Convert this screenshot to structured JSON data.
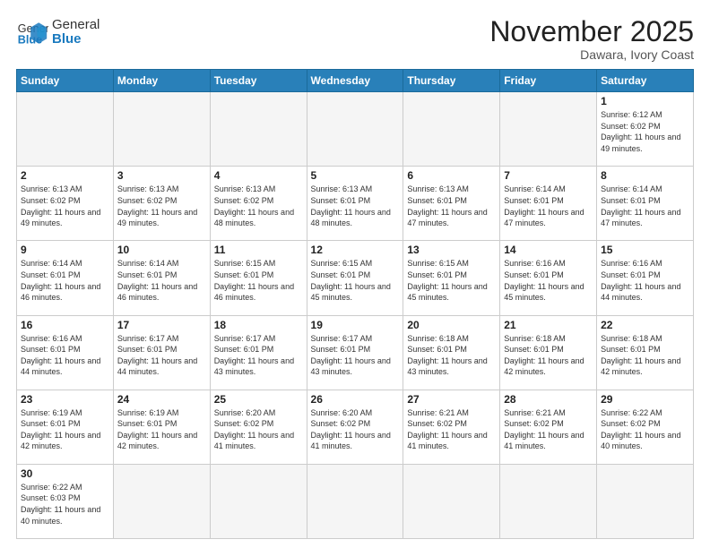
{
  "header": {
    "logo_general": "General",
    "logo_blue": "Blue",
    "title": "November 2025",
    "location": "Dawara, Ivory Coast"
  },
  "days_of_week": [
    "Sunday",
    "Monday",
    "Tuesday",
    "Wednesday",
    "Thursday",
    "Friday",
    "Saturday"
  ],
  "weeks": [
    [
      {
        "day": null
      },
      {
        "day": null
      },
      {
        "day": null
      },
      {
        "day": null
      },
      {
        "day": null
      },
      {
        "day": null
      },
      {
        "day": 1,
        "sunrise": "Sunrise: 6:12 AM",
        "sunset": "Sunset: 6:02 PM",
        "daylight": "Daylight: 11 hours and 49 minutes."
      }
    ],
    [
      {
        "day": 2,
        "sunrise": "Sunrise: 6:13 AM",
        "sunset": "Sunset: 6:02 PM",
        "daylight": "Daylight: 11 hours and 49 minutes."
      },
      {
        "day": 3,
        "sunrise": "Sunrise: 6:13 AM",
        "sunset": "Sunset: 6:02 PM",
        "daylight": "Daylight: 11 hours and 49 minutes."
      },
      {
        "day": 4,
        "sunrise": "Sunrise: 6:13 AM",
        "sunset": "Sunset: 6:02 PM",
        "daylight": "Daylight: 11 hours and 48 minutes."
      },
      {
        "day": 5,
        "sunrise": "Sunrise: 6:13 AM",
        "sunset": "Sunset: 6:01 PM",
        "daylight": "Daylight: 11 hours and 48 minutes."
      },
      {
        "day": 6,
        "sunrise": "Sunrise: 6:13 AM",
        "sunset": "Sunset: 6:01 PM",
        "daylight": "Daylight: 11 hours and 47 minutes."
      },
      {
        "day": 7,
        "sunrise": "Sunrise: 6:14 AM",
        "sunset": "Sunset: 6:01 PM",
        "daylight": "Daylight: 11 hours and 47 minutes."
      },
      {
        "day": 8,
        "sunrise": "Sunrise: 6:14 AM",
        "sunset": "Sunset: 6:01 PM",
        "daylight": "Daylight: 11 hours and 47 minutes."
      }
    ],
    [
      {
        "day": 9,
        "sunrise": "Sunrise: 6:14 AM",
        "sunset": "Sunset: 6:01 PM",
        "daylight": "Daylight: 11 hours and 46 minutes."
      },
      {
        "day": 10,
        "sunrise": "Sunrise: 6:14 AM",
        "sunset": "Sunset: 6:01 PM",
        "daylight": "Daylight: 11 hours and 46 minutes."
      },
      {
        "day": 11,
        "sunrise": "Sunrise: 6:15 AM",
        "sunset": "Sunset: 6:01 PM",
        "daylight": "Daylight: 11 hours and 46 minutes."
      },
      {
        "day": 12,
        "sunrise": "Sunrise: 6:15 AM",
        "sunset": "Sunset: 6:01 PM",
        "daylight": "Daylight: 11 hours and 45 minutes."
      },
      {
        "day": 13,
        "sunrise": "Sunrise: 6:15 AM",
        "sunset": "Sunset: 6:01 PM",
        "daylight": "Daylight: 11 hours and 45 minutes."
      },
      {
        "day": 14,
        "sunrise": "Sunrise: 6:16 AM",
        "sunset": "Sunset: 6:01 PM",
        "daylight": "Daylight: 11 hours and 45 minutes."
      },
      {
        "day": 15,
        "sunrise": "Sunrise: 6:16 AM",
        "sunset": "Sunset: 6:01 PM",
        "daylight": "Daylight: 11 hours and 44 minutes."
      }
    ],
    [
      {
        "day": 16,
        "sunrise": "Sunrise: 6:16 AM",
        "sunset": "Sunset: 6:01 PM",
        "daylight": "Daylight: 11 hours and 44 minutes."
      },
      {
        "day": 17,
        "sunrise": "Sunrise: 6:17 AM",
        "sunset": "Sunset: 6:01 PM",
        "daylight": "Daylight: 11 hours and 44 minutes."
      },
      {
        "day": 18,
        "sunrise": "Sunrise: 6:17 AM",
        "sunset": "Sunset: 6:01 PM",
        "daylight": "Daylight: 11 hours and 43 minutes."
      },
      {
        "day": 19,
        "sunrise": "Sunrise: 6:17 AM",
        "sunset": "Sunset: 6:01 PM",
        "daylight": "Daylight: 11 hours and 43 minutes."
      },
      {
        "day": 20,
        "sunrise": "Sunrise: 6:18 AM",
        "sunset": "Sunset: 6:01 PM",
        "daylight": "Daylight: 11 hours and 43 minutes."
      },
      {
        "day": 21,
        "sunrise": "Sunrise: 6:18 AM",
        "sunset": "Sunset: 6:01 PM",
        "daylight": "Daylight: 11 hours and 42 minutes."
      },
      {
        "day": 22,
        "sunrise": "Sunrise: 6:18 AM",
        "sunset": "Sunset: 6:01 PM",
        "daylight": "Daylight: 11 hours and 42 minutes."
      }
    ],
    [
      {
        "day": 23,
        "sunrise": "Sunrise: 6:19 AM",
        "sunset": "Sunset: 6:01 PM",
        "daylight": "Daylight: 11 hours and 42 minutes."
      },
      {
        "day": 24,
        "sunrise": "Sunrise: 6:19 AM",
        "sunset": "Sunset: 6:01 PM",
        "daylight": "Daylight: 11 hours and 42 minutes."
      },
      {
        "day": 25,
        "sunrise": "Sunrise: 6:20 AM",
        "sunset": "Sunset: 6:02 PM",
        "daylight": "Daylight: 11 hours and 41 minutes."
      },
      {
        "day": 26,
        "sunrise": "Sunrise: 6:20 AM",
        "sunset": "Sunset: 6:02 PM",
        "daylight": "Daylight: 11 hours and 41 minutes."
      },
      {
        "day": 27,
        "sunrise": "Sunrise: 6:21 AM",
        "sunset": "Sunset: 6:02 PM",
        "daylight": "Daylight: 11 hours and 41 minutes."
      },
      {
        "day": 28,
        "sunrise": "Sunrise: 6:21 AM",
        "sunset": "Sunset: 6:02 PM",
        "daylight": "Daylight: 11 hours and 41 minutes."
      },
      {
        "day": 29,
        "sunrise": "Sunrise: 6:22 AM",
        "sunset": "Sunset: 6:02 PM",
        "daylight": "Daylight: 11 hours and 40 minutes."
      }
    ],
    [
      {
        "day": 30,
        "sunrise": "Sunrise: 6:22 AM",
        "sunset": "Sunset: 6:03 PM",
        "daylight": "Daylight: 11 hours and 40 minutes."
      },
      {
        "day": null
      },
      {
        "day": null
      },
      {
        "day": null
      },
      {
        "day": null
      },
      {
        "day": null
      },
      {
        "day": null
      }
    ]
  ]
}
